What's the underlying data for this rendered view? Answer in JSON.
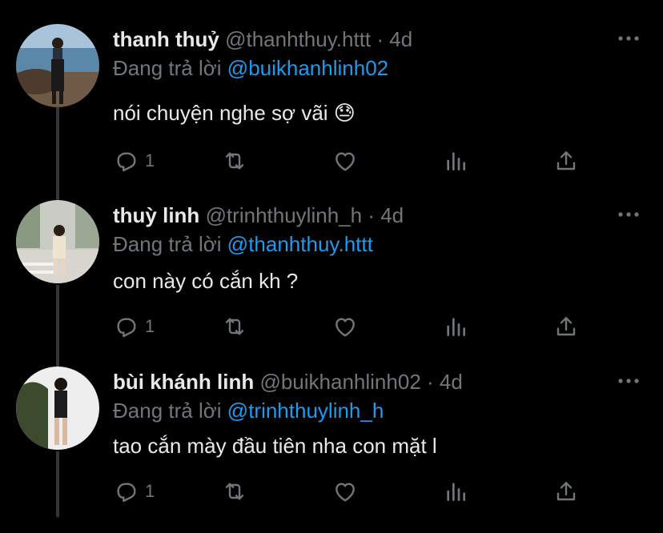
{
  "tweets": [
    {
      "name": "thanh thuỷ",
      "handle": "@thanhthuy.httt",
      "separator": "·",
      "time": "4d",
      "reply_label": "Đang trả lời",
      "reply_to": "@buikhanhlinh02",
      "text": "nói chuyện nghe sợ vãi",
      "emoji": "😓",
      "reply_count": "1"
    },
    {
      "name": "thuỳ linh",
      "handle": "@trinhthuylinh_h",
      "separator": "·",
      "time": "4d",
      "reply_label": "Đang trả lời",
      "reply_to": "@thanhthuy.httt",
      "text": "con này có cắn kh ?",
      "emoji": "",
      "reply_count": "1"
    },
    {
      "name": "bùi khánh linh",
      "handle": "@buikhanhlinh02",
      "separator": "·",
      "time": "4d",
      "reply_label": "Đang trả lời",
      "reply_to": "@trinhthuylinh_h",
      "text": "tao cắn mày đầu tiên nha con mặt l",
      "emoji": "",
      "reply_count": "1"
    }
  ],
  "icons": {
    "reply": "reply-icon",
    "retweet": "retweet-icon",
    "like": "heart-icon",
    "views": "analytics-icon",
    "share": "share-icon",
    "more": "more-icon"
  },
  "colors": {
    "background": "#000000",
    "text": "#e7e9ea",
    "secondary": "#71767b",
    "accent": "#1d9bf0",
    "thread_line": "#333639"
  }
}
